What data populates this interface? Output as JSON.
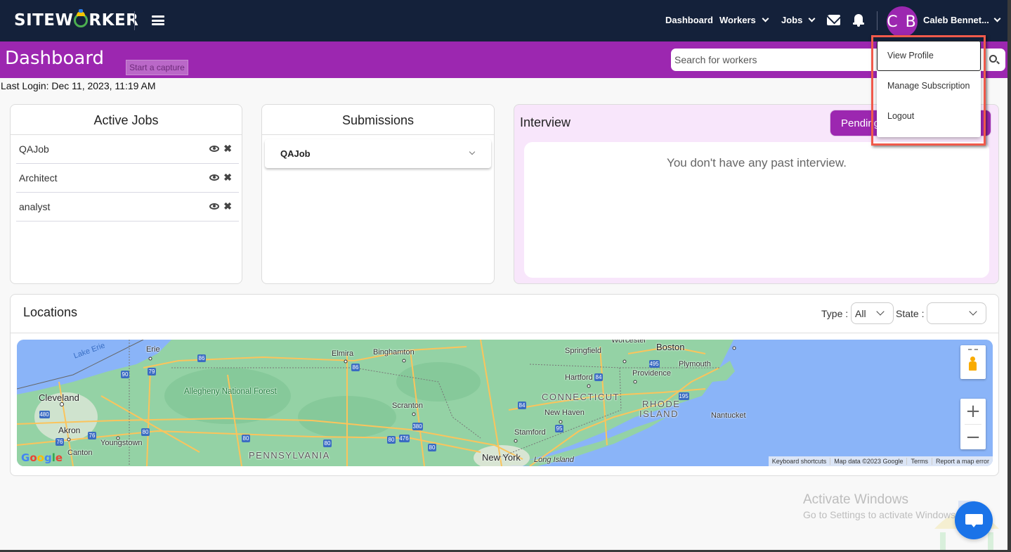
{
  "app": {
    "brand_left": "SITEW",
    "brand_right": "RKER"
  },
  "topnav": {
    "links": [
      {
        "label": "Dashboard"
      },
      {
        "label": "Workers"
      },
      {
        "label": "Jobs"
      }
    ],
    "avatar_initials": "C B",
    "username": "Caleb Bennet..."
  },
  "header": {
    "title": "Dashboard",
    "capture_tooltip": "Start a capture",
    "search_placeholder": "Search for workers",
    "search_value": ""
  },
  "last_login": "Last Login: Dec 11, 2023, 11:19 AM",
  "active_jobs": {
    "title": "Active Jobs",
    "items": [
      {
        "name": "QAJob"
      },
      {
        "name": "Architect"
      },
      {
        "name": "analyst"
      }
    ]
  },
  "submissions": {
    "title": "Submissions",
    "items": [
      {
        "name": "QAJob"
      }
    ]
  },
  "interview": {
    "title": "Interview",
    "tab_pending": "Pending",
    "empty_message": "You don't have any past interview."
  },
  "locations": {
    "title": "Locations",
    "type_label": "Type :",
    "type_value": "All",
    "state_label": "State :",
    "state_value": "",
    "map": {
      "labels": {
        "lake_erie": "Lake Erie",
        "erie": "Erie",
        "elmira": "Elmira",
        "binghamton": "Binghamton",
        "springfield": "Springfield",
        "worcester": "Worcester",
        "boston": "Boston",
        "plymouth": "Plymouth",
        "providence": "Providence",
        "hartford": "Hartford",
        "cleveland": "Cleveland",
        "allegheny": "Allegheny National Forest",
        "scranton": "Scranton",
        "connecticut": "CONNECTICUT",
        "rhode_island_1": "RHODE",
        "rhode_island_2": "ISLAND",
        "new_haven": "New Haven",
        "nantucket": "Nantucket",
        "akron": "Akron",
        "youngstown": "Youngstown",
        "canton": "Canton",
        "stamford": "Stamford",
        "pennsylvania": "PENNSYLVANIA",
        "new_york": "New York",
        "long_island": "Long Island"
      },
      "zoom_in": "+",
      "zoom_out": "−",
      "google": "Google",
      "attribution": {
        "shortcuts": "Keyboard shortcuts",
        "map_data": "Map data ©2023 Google",
        "terms": "Terms",
        "report": "Report a map error"
      }
    }
  },
  "profile_menu": {
    "items": [
      {
        "label": "View Profile"
      },
      {
        "label": "Manage Subscription"
      },
      {
        "label": "Logout"
      }
    ]
  },
  "watermark": {
    "line1": "Activate Windows",
    "line2": "Go to Settings to activate Windows."
  },
  "colors": {
    "nav_bg": "#14213a",
    "brand_purple": "#9c27b0",
    "interview_bg": "#f8e6fb",
    "highlight_red": "#f15a4b",
    "chat_blue": "#1a73e8"
  }
}
